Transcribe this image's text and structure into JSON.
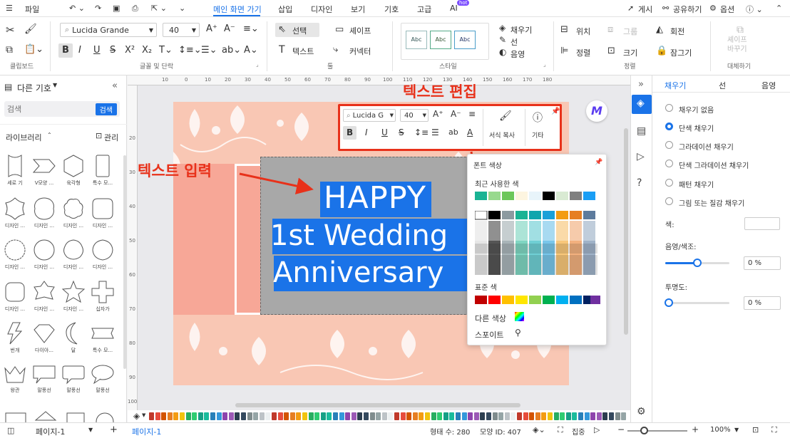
{
  "menubar": {
    "file": "파일",
    "tabs": [
      "메인 화면 가기",
      "삽입",
      "디자인",
      "보기",
      "기호",
      "고급",
      "AI"
    ],
    "ai_badge": "hot",
    "right": [
      "게시",
      "공유하기",
      "옵션"
    ]
  },
  "ribbon": {
    "font_name": "Lucida Grande",
    "font_size": "40",
    "select": "선택",
    "shape": "셰이프",
    "text": "텍스트",
    "connector": "커넥터",
    "fill": "채우기",
    "line": "선",
    "shadow": "음영",
    "position": "위치",
    "group": "그룹",
    "rotate": "회전",
    "align": "정렬",
    "size": "크기",
    "lock": "잠그기",
    "replace": "셰이프\n바꾸기",
    "style_abc": "Abc",
    "groups": {
      "clipboard": "클립보드",
      "font": "글꼴 및 단락",
      "tools": "툴",
      "style": "스타일",
      "arrange": "정렬",
      "replace": "대체하기"
    }
  },
  "left": {
    "title": "다른 기호",
    "search_placeholder": "검색",
    "search_btn": "검색",
    "library": "라이브러리",
    "manage": "관리",
    "shapes": [
      "세로 기",
      "V모양 ...",
      "육각형",
      "특수 모...",
      "디자인 ...",
      "디자인 ...",
      "디자인 ...",
      "디자인 ...",
      "디자인 ...",
      "디자인 ...",
      "디자인 ...",
      "디자인 ...",
      "디자인 ...",
      "디자인 ...",
      "디자인 ...",
      "십자가",
      "번개",
      "다이아...",
      "달",
      "특수 모...",
      "왕관",
      "말풍선",
      "말풍선",
      "말풍선"
    ]
  },
  "ruler_top": [
    "10",
    "0",
    "10",
    "20",
    "30",
    "40",
    "50",
    "60",
    "70",
    "80",
    "90",
    "100",
    "110",
    "120",
    "130",
    "140",
    "150",
    "160",
    "170",
    "180"
  ],
  "ruler_left": [
    "20",
    "30",
    "40",
    "50",
    "60",
    "70",
    "80",
    "90",
    "100"
  ],
  "canvas": {
    "line1": "HAPPY",
    "line2": "1st Wedding",
    "line3": "Anniversary"
  },
  "annotations": {
    "edit": "텍스트 편집",
    "input": "텍스트 입력"
  },
  "floattb": {
    "font": "Lucida G",
    "size": "40",
    "format_copy": "서식 복사",
    "more": "기타"
  },
  "colorpop": {
    "title": "폰트 색상",
    "recent": "최근 사용한 색",
    "standard": "표준 색",
    "other": "다른 색상",
    "eyedrop": "스포이트"
  },
  "right": {
    "tabs": [
      "채우기",
      "선",
      "음영"
    ],
    "options": [
      "채우기 없음",
      "단색 채우기",
      "그라데이션 채우기",
      "단색 그라데이션 채우기",
      "패턴 채우기",
      "그림 또는 질감 채우기"
    ],
    "color_label": "색:",
    "shade_label": "음영/색조:",
    "shade_val": "0 %",
    "transp_label": "투명도:",
    "transp_val": "0 %"
  },
  "status": {
    "page_sel": "페이지-1",
    "page_tab": "페이지-1",
    "shape_count": "형태 수: 280",
    "shape_id": "모양 ID: 407",
    "focus": "집중",
    "zoom": "100%"
  },
  "colors": {
    "accent": "#1a73e8",
    "highlight": "#e8311a",
    "card": "#f9c7b4",
    "selbg": "#a8a8a8"
  }
}
